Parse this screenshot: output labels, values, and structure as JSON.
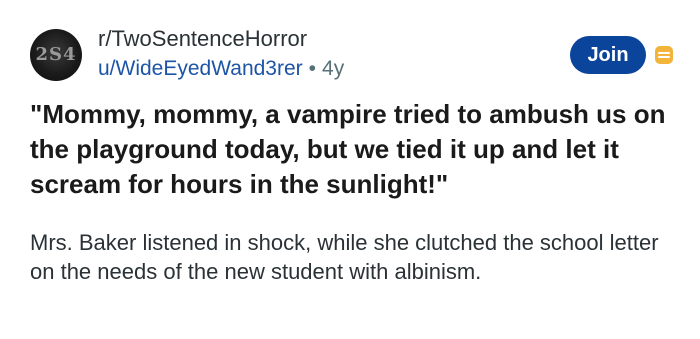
{
  "post": {
    "subreddit": "r/TwoSentenceHorror",
    "author": "u/WideEyedWand3rer",
    "separator": "•",
    "age": "4y",
    "avatar_text": "2S4",
    "join_label": "Join",
    "title": "\"Mommy, mommy, a vampire tried to ambush us on the playground today, but we tied it up and let it scream for hours in the sunlight!\"",
    "body": "Mrs. Baker listened in shock, while she clutched the school letter on the needs of the new student with albinism."
  },
  "colors": {
    "join_button": "#0a449b",
    "author_link": "#1d55a6",
    "mod_icon": "#f2b43a",
    "meta_gray": "#576f76"
  },
  "icons": {
    "avatar": "subreddit-avatar",
    "mod": "mod-shield-icon"
  }
}
